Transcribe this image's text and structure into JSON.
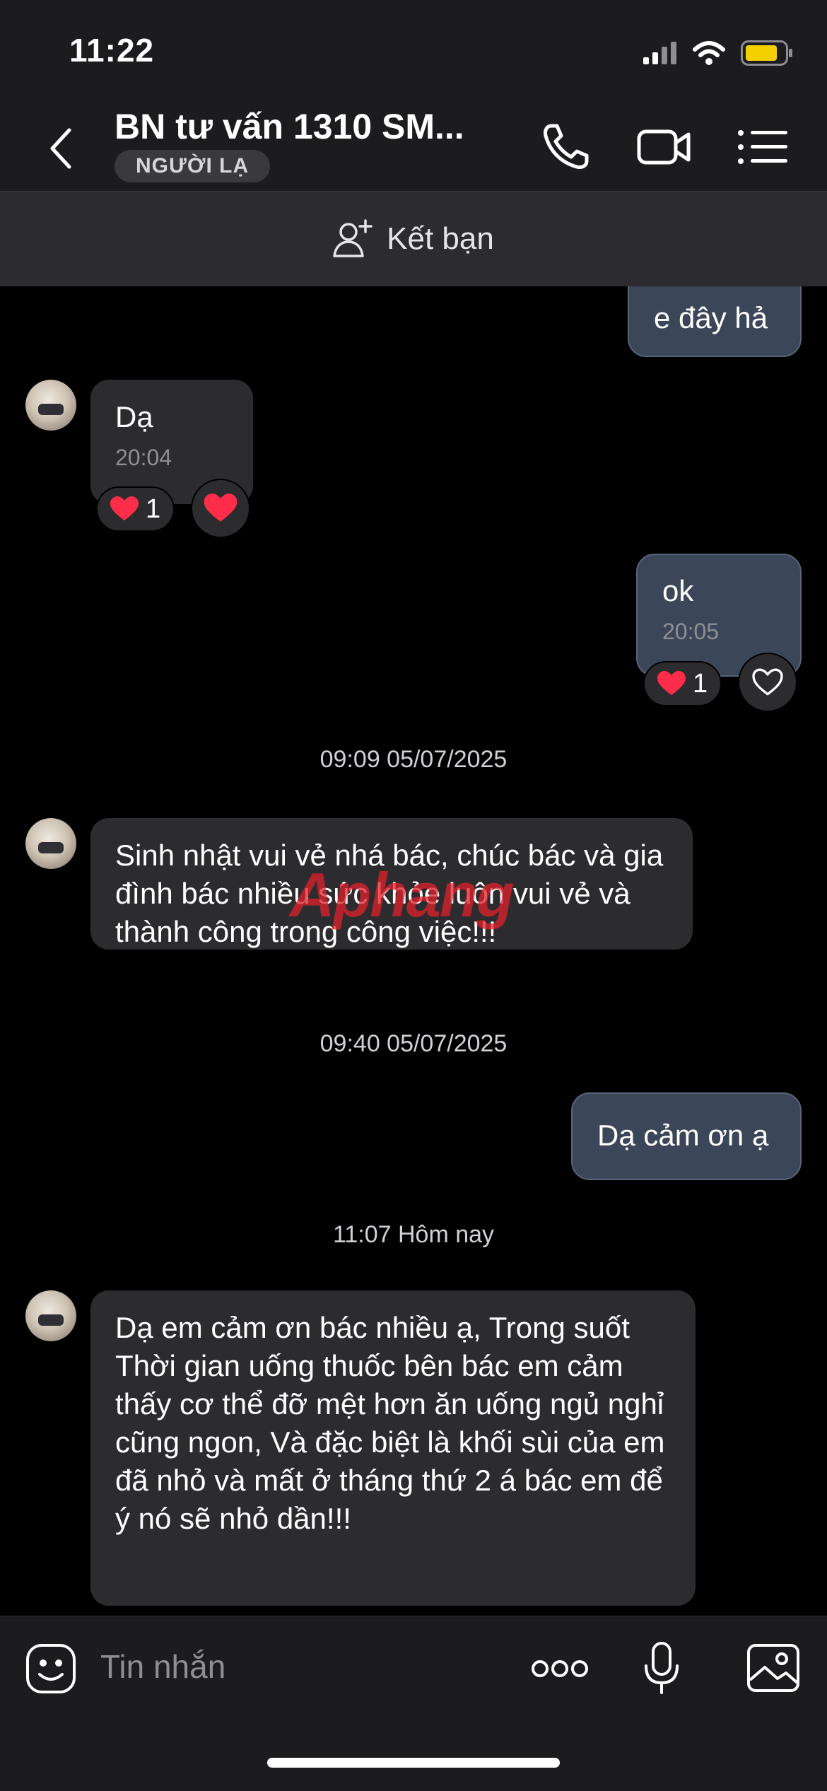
{
  "status_bar": {
    "time": "11:22"
  },
  "header": {
    "title": "BN tư vấn 1310 SM...",
    "badge": "NGƯỜI LẠ"
  },
  "friend_bar": {
    "label": "Kết bạn"
  },
  "messages": {
    "m1": {
      "text": "e đây hả"
    },
    "m2": {
      "text": "Dạ",
      "time": "20:04",
      "reaction_count": "1"
    },
    "m3": {
      "text": "ok",
      "time": "20:05",
      "reaction_count": "1"
    },
    "sep1": "09:09 05/07/2025",
    "m4": {
      "text": "Sinh nhật vui vẻ nhá bác, chúc bác và gia đình bác nhiều sức khỏe luôn vui vẻ và thành công trong công việc!!!"
    },
    "sep2": "09:40 05/07/2025",
    "m5": {
      "text": "Dạ cảm ơn ạ"
    },
    "sep3": "11:07 Hôm nay",
    "m6": {
      "text": "Dạ em cảm ơn bác nhiều ạ, Trong suốt Thời gian uống thuốc bên bác em cảm thấy cơ thể đỡ mệt hơn ăn uống ngủ nghỉ cũng ngon, Và đặc biệt là khối sùi của em đã nhỏ và mất ở tháng thứ 2 á bác em để ý nó sẽ nhỏ dần!!!"
    }
  },
  "watermark": "Aphang",
  "composer": {
    "placeholder": "Tin nhắn"
  },
  "colors": {
    "background": "#000000",
    "header": "#1c1c1e",
    "incoming_bubble": "#2c2c2e",
    "outgoing_bubble": "#3b4758",
    "battery": "#f5d000",
    "heart": "#ff2d4a"
  },
  "icons": {
    "status": [
      "signal-icon",
      "wifi-icon",
      "battery-icon"
    ],
    "header": [
      "back-icon",
      "phone-icon",
      "video-call-icon",
      "menu-icon"
    ],
    "composer": [
      "emoji-icon",
      "more-icon",
      "microphone-icon",
      "gallery-icon"
    ]
  }
}
